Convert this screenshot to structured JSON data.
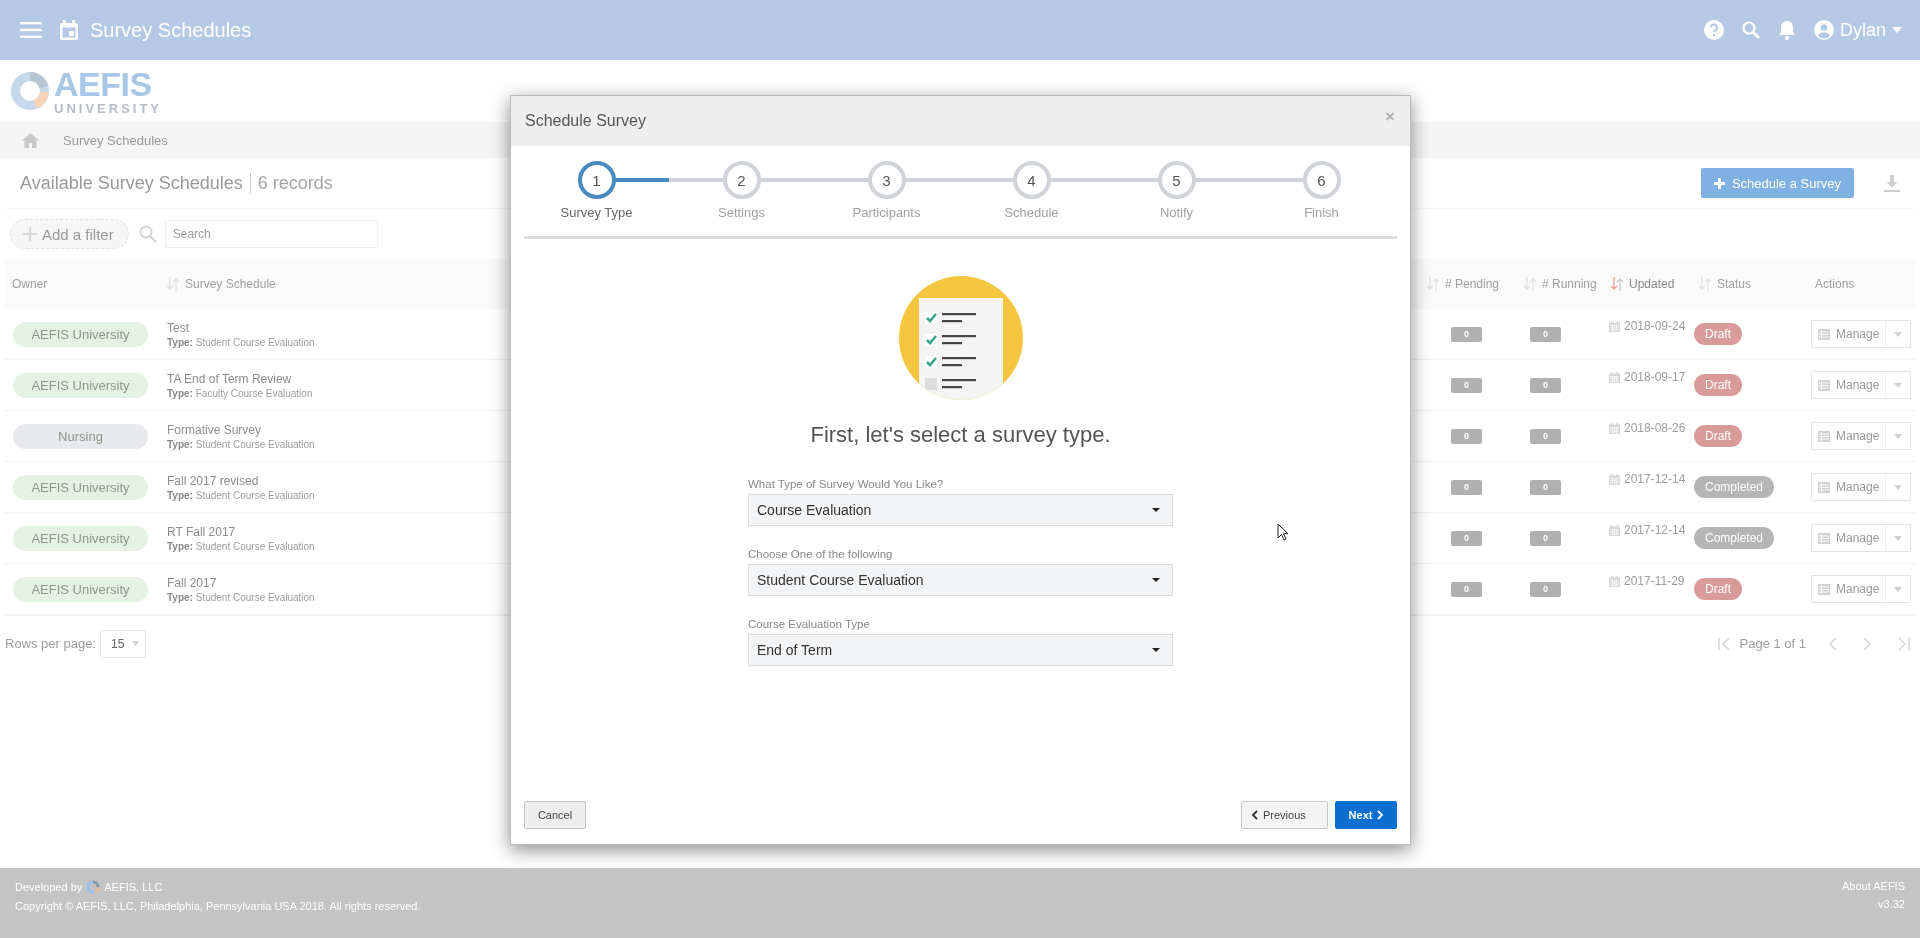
{
  "topbar": {
    "title": "Survey Schedules",
    "user": "Dylan"
  },
  "logo": {
    "name": "AEFIS",
    "subtitle": "UNIVERSITY"
  },
  "breadcrumb": [
    "Survey Schedules"
  ],
  "page": {
    "title": "Available Survey Schedules",
    "count": "6 records",
    "add_filter": "Add a filter",
    "search_placeholder": "Search",
    "schedule_button": "Schedule a Survey"
  },
  "table": {
    "columns": [
      {
        "label": "Owner",
        "sortable": false,
        "sorted": false
      },
      {
        "label": "Survey Schedule",
        "sortable": true,
        "sorted": false
      },
      {
        "label": "# Pending",
        "sortable": true,
        "sorted": false
      },
      {
        "label": "# Running",
        "sortable": true,
        "sorted": false
      },
      {
        "label": "Updated",
        "sortable": true,
        "sorted": true
      },
      {
        "label": "Status",
        "sortable": true,
        "sorted": false
      },
      {
        "label": "Actions",
        "sortable": false,
        "sorted": false
      }
    ],
    "rows": [
      {
        "owner": {
          "label": "AEFIS University",
          "color": "#e3f2e3"
        },
        "name": "Test",
        "type": "**Type:** Student Course Evaluation",
        "pending": "0",
        "running": "0",
        "updated": "2018-09-24",
        "status": {
          "label": "Draft",
          "color": "#d99a9a"
        },
        "action": "Manage"
      },
      {
        "owner": {
          "label": "AEFIS University",
          "color": "#e3f2e3"
        },
        "name": "TA End of Term Review",
        "type": "**Type:** Faculty Course Evaluation",
        "pending": "0",
        "running": "0",
        "updated": "2018-09-17",
        "status": {
          "label": "Draft",
          "color": "#d99a9a"
        },
        "action": "Manage"
      },
      {
        "owner": {
          "label": "Nursing",
          "color": "#e8e9ec"
        },
        "name": "Formative Survey",
        "type": "**Type:** Student Course Evaluation",
        "pending": "0",
        "running": "0",
        "updated": "2018-08-26",
        "status": {
          "label": "Draft",
          "color": "#d99a9a"
        },
        "action": "Manage"
      },
      {
        "owner": {
          "label": "AEFIS University",
          "color": "#e3f2e3"
        },
        "name": "Fall 2017 revised",
        "type": "**Type:** Student Course Evaluation",
        "pending": "0",
        "running": "0",
        "updated": "2017-12-14",
        "status": {
          "label": "Completed",
          "color": "#b5b5b5"
        },
        "action": "Manage"
      },
      {
        "owner": {
          "label": "AEFIS University",
          "color": "#e3f2e3"
        },
        "name": "RT Fall 2017",
        "type": "**Type:** Student Course Evaluation",
        "pending": "0",
        "running": "0",
        "updated": "2017-12-14",
        "status": {
          "label": "Completed",
          "color": "#b5b5b5"
        },
        "action": "Manage"
      },
      {
        "owner": {
          "label": "AEFIS University",
          "color": "#e3f2e3"
        },
        "name": "Fall 2017",
        "type": "**Type:** Student Course Evaluation",
        "pending": "0",
        "running": "0",
        "updated": "2017-11-29",
        "status": {
          "label": "Draft",
          "color": "#d99a9a"
        },
        "action": "Manage"
      }
    ]
  },
  "rows_per_page": {
    "label": "Rows per page:",
    "value": "15"
  },
  "pager": {
    "text": "Page 1 of 1"
  },
  "footer": {
    "developed_by": "Developed by",
    "company": "AEFIS, LLC",
    "copyright": "Copyright © AEFIS, LLC, Philadelphia, Pennsylvania USA 2018. All rights reserved.",
    "about": "About AEFIS",
    "version": "v3.32"
  },
  "modal": {
    "title": "Schedule Survey",
    "close": "×",
    "steps": [
      {
        "number": "1",
        "label": "Survey Type",
        "selected": true
      },
      {
        "number": "2",
        "label": "Settings",
        "selected": false
      },
      {
        "number": "3",
        "label": "Participants",
        "selected": false
      },
      {
        "number": "4",
        "label": "Schedule",
        "selected": false
      },
      {
        "number": "5",
        "label": "Notify",
        "selected": false
      },
      {
        "number": "6",
        "label": "Finish",
        "selected": false
      }
    ],
    "heading": "First, let's select a survey type.",
    "fields": [
      {
        "label": "What Type of Survey Would You Like?",
        "value": "Course Evaluation"
      },
      {
        "label": "Choose One of the following",
        "value": "Student Course Evaluation"
      },
      {
        "label": "Course Evaluation Type",
        "value": "End of Term"
      }
    ],
    "cancel": "Cancel",
    "previous": "Previous",
    "next": "Next"
  }
}
